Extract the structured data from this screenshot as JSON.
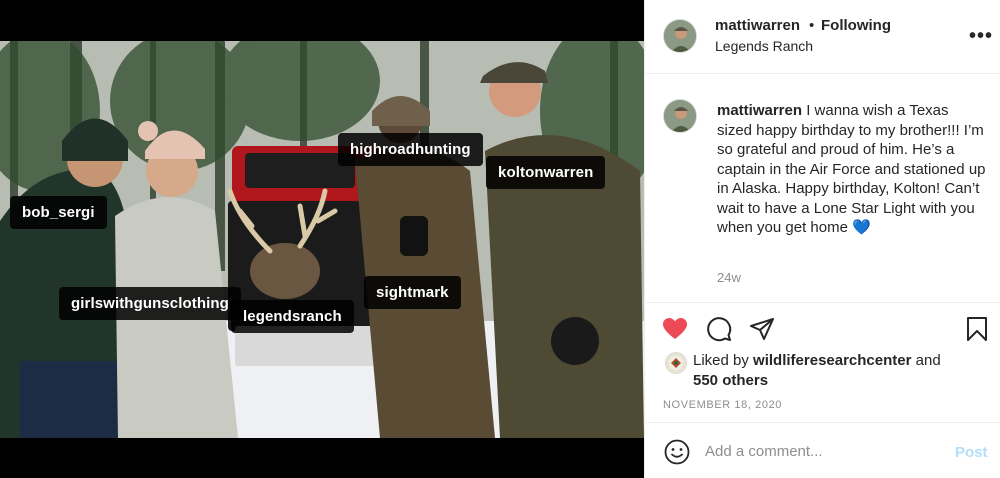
{
  "media": {
    "tags": [
      {
        "name": "bob_sergi"
      },
      {
        "name": "girlswithgunsclothing"
      },
      {
        "name": "legendsranch"
      },
      {
        "name": "highroadhunting"
      },
      {
        "name": "koltonwarren"
      },
      {
        "name": "sightmark"
      }
    ],
    "user_tag_icon": "person-icon"
  },
  "header": {
    "username": "mattiwarren",
    "dot": "•",
    "follow_status": "Following",
    "location": "Legends Ranch",
    "more_icon": "more-horizontal-icon",
    "more_label": "•••"
  },
  "caption": {
    "username": "mattiwarren",
    "text": " I wanna wish a Texas sized happy birthday to my brother!!! I’m so grateful and proud of him. He’s a captain in the Air Force and stationed up in Alaska. Happy birthday, Kolton! Can’t wait to have a Lone Star Light with you when you get home ",
    "emoji": "💙",
    "age": "24w"
  },
  "actions": {
    "like_icon": "heart-icon",
    "comment_icon": "comment-icon",
    "share_icon": "share-icon",
    "save_icon": "bookmark-icon",
    "like_color": "#ed4956"
  },
  "likes": {
    "prefix": "Liked by ",
    "user": "wildliferesearchcenter",
    "connector": " and",
    "others": "550 others"
  },
  "date": "NOVEMBER 18, 2020",
  "add_comment": {
    "placeholder": "Add a comment...",
    "post_label": "Post",
    "post_color": "#b2dffc"
  }
}
